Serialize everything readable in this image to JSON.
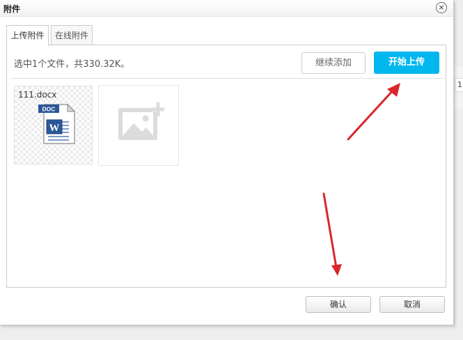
{
  "dialog": {
    "title": "附件",
    "close_glyph": "×"
  },
  "tabs": [
    {
      "label": "上传附件",
      "active": true
    },
    {
      "label": "在线附件",
      "active": false
    }
  ],
  "upload": {
    "status_text": "选中1个文件，共330.32K。",
    "continue_label": "继续添加",
    "start_label": "开始上传"
  },
  "files": [
    {
      "name": "111.docx",
      "icon": "word-doc-icon",
      "badge": "DOC",
      "glyph": "W"
    }
  ],
  "add_tile": {
    "icon": "add-image-icon"
  },
  "footer": {
    "confirm_label": "确认",
    "cancel_label": "取消"
  },
  "background_page": {
    "edge_text": "1"
  },
  "colors": {
    "accent": "#00b7ee",
    "annotation_arrow": "#d9262b"
  }
}
